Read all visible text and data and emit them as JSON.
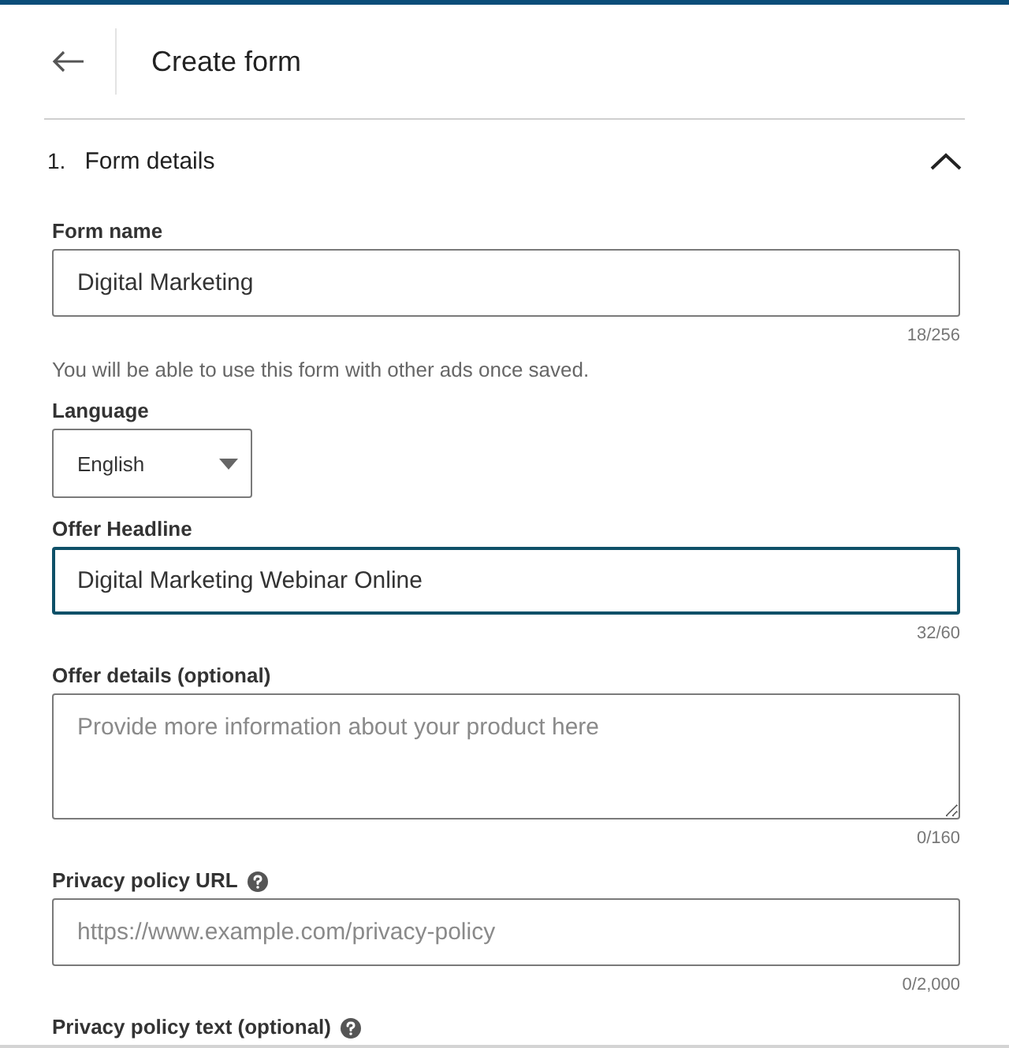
{
  "header": {
    "title": "Create form"
  },
  "section": {
    "number": "1.",
    "title": "Form details",
    "expanded": true
  },
  "fields": [
    {
      "kind": "text",
      "label": "Form name",
      "value": "Digital Marketing",
      "counter": "18/256",
      "focused": false,
      "note": "You will be able to use this form with other ads once saved."
    },
    {
      "kind": "select",
      "label": "Language",
      "value": "English"
    },
    {
      "kind": "text",
      "label": "Offer Headline",
      "value": "Digital Marketing Webinar Online",
      "counter": "32/60",
      "focused": true
    },
    {
      "kind": "textarea",
      "label": "Offer details (optional)",
      "placeholder": "Provide more information about your product here",
      "counter": "0/160",
      "focused": false
    },
    {
      "kind": "text",
      "label": "Privacy policy URL",
      "help": true,
      "placeholder": "https://www.example.com/privacy-policy",
      "counter": "0/2,000",
      "focused": false
    },
    {
      "kind": "label",
      "label": "Privacy policy text (optional)",
      "help": true
    }
  ]
}
